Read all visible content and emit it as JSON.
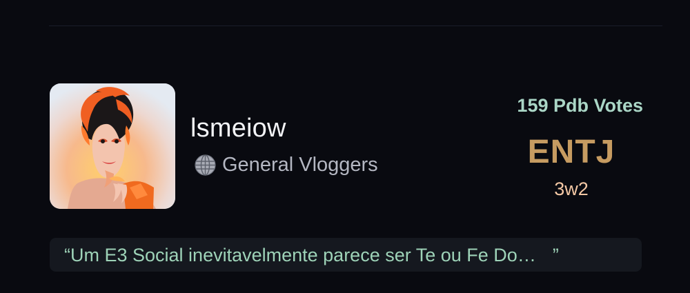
{
  "profile": {
    "name": "lsmeiow",
    "category": "General Vloggers",
    "category_icon": "globe-icon",
    "avatar_icon": "profile-avatar-image"
  },
  "stats": {
    "votes": "159 Pdb Votes",
    "personality_type": "ENTJ",
    "enneagram": "3w2"
  },
  "quote": {
    "open_mark": "“",
    "text": "Um E3 Social inevitavelmente parece ser Te ou Fe Do…",
    "close_mark": "”"
  },
  "colors": {
    "background": "#090a10",
    "personality": "#c69b61",
    "votes": "#aad6c6",
    "quote_text": "#9ed3b8"
  }
}
